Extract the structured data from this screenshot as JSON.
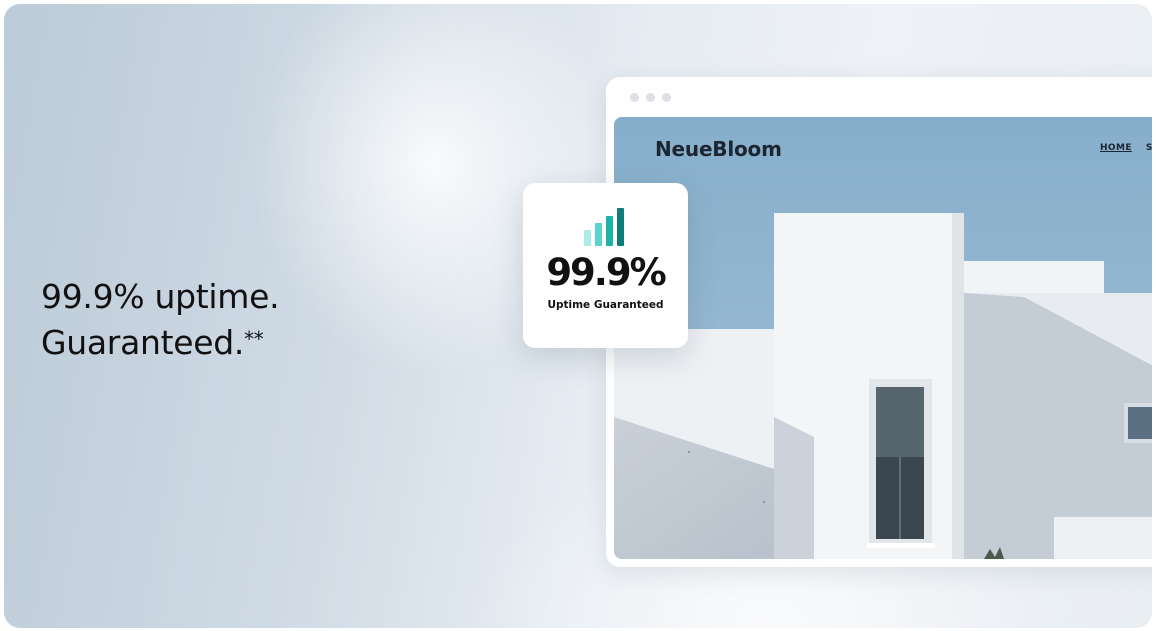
{
  "headline": {
    "line1": "99.9% uptime.",
    "line2": "Guaranteed.",
    "footnote_mark": "**"
  },
  "uptime_card": {
    "value": "99.9%",
    "caption": "Uptime Guaranteed",
    "signal_icon": "signal-bars-icon",
    "bar_colors": [
      "#a9ece8",
      "#59d3cd",
      "#1fb2ad",
      "#0f7c7a"
    ]
  },
  "browser_preview": {
    "site_name": "NeueBloom",
    "nav": [
      {
        "label": "HOME",
        "active": true
      },
      {
        "label": "SE",
        "active": false
      }
    ]
  }
}
